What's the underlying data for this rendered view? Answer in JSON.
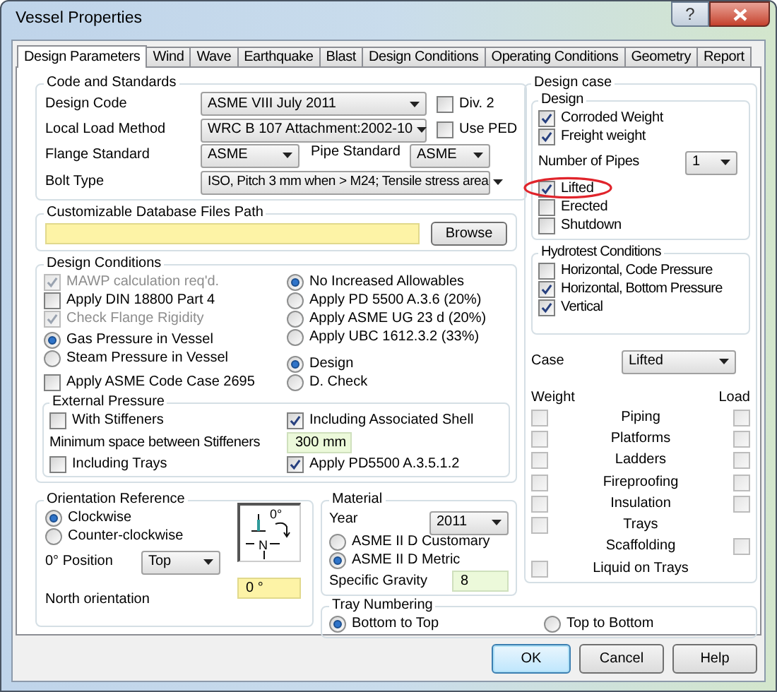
{
  "window": {
    "title": "Vessel Properties",
    "help_button": "?"
  },
  "tabs": [
    {
      "label": "Design Parameters",
      "selected": true
    },
    {
      "label": "Wind",
      "selected": false
    },
    {
      "label": "Wave",
      "selected": false
    },
    {
      "label": "Earthquake",
      "selected": false
    },
    {
      "label": "Blast",
      "selected": false
    },
    {
      "label": "Design Conditions",
      "selected": false
    },
    {
      "label": "Operating Conditions",
      "selected": false
    },
    {
      "label": "Geometry",
      "selected": false
    },
    {
      "label": "Report",
      "selected": false
    }
  ],
  "code_and_standards": {
    "title": "Code and Standards",
    "design_code": {
      "label": "Design Code",
      "value": "ASME VIII July 2011"
    },
    "div2": {
      "label": "Div. 2",
      "checked": false
    },
    "local_load_method": {
      "label": "Local Load Method",
      "value": "WRC B 107 Attachment:2002-10"
    },
    "use_ped": {
      "label": "Use PED",
      "checked": false
    },
    "flange_standard": {
      "label": "Flange Standard",
      "value": "ASME"
    },
    "pipe_standard": {
      "label": "Pipe Standard",
      "value": "ASME"
    },
    "bolt_type": {
      "label": "Bolt Type",
      "value": "ISO, Pitch 3 mm when > M24; Tensile stress area"
    }
  },
  "database_path": {
    "title": "Customizable Database Files Path",
    "browse_button": "Browse"
  },
  "design_conditions": {
    "title": "Design Conditions",
    "options": [
      {
        "label": "MAWP calculation req'd.",
        "checked": true,
        "disabled": true
      },
      {
        "label": "Apply DIN 18800 Part 4",
        "checked": false,
        "disabled": false
      },
      {
        "label": "Check Flange Rigidity",
        "checked": true,
        "disabled": true
      }
    ],
    "pressure_medium": [
      {
        "label": "Gas Pressure in Vessel",
        "selected": true
      },
      {
        "label": "Steam Pressure in Vessel",
        "selected": false
      }
    ],
    "code_case": {
      "label": "Apply ASME Code Case 2695",
      "checked": false
    },
    "allowables": [
      {
        "label": "No Increased Allowables",
        "selected": true
      },
      {
        "label": "Apply PD 5500 A.3.6 (20%)",
        "selected": false
      },
      {
        "label": "Apply ASME UG 23 d (20%)",
        "selected": false
      },
      {
        "label": "Apply UBC 1612.3.2 (33%)",
        "selected": false
      }
    ],
    "check_mode": [
      {
        "label": "Design",
        "selected": true
      },
      {
        "label": "D. Check",
        "selected": false
      }
    ],
    "external_pressure": {
      "title": "External Pressure",
      "with_stiffeners": {
        "label": "With Stiffeners",
        "checked": false
      },
      "including_shell": {
        "label": "Including Associated Shell",
        "checked": true
      },
      "min_space": {
        "label": "Minimum space between Stiffeners",
        "value": "300 mm"
      },
      "including_trays": {
        "label": "Including Trays",
        "checked": false
      },
      "apply_pd5500": {
        "label": "Apply PD5500 A.3.5.1.2",
        "checked": true
      }
    }
  },
  "orientation": {
    "title": "Orientation Reference",
    "direction": [
      {
        "label": "Clockwise",
        "selected": true
      },
      {
        "label": "Counter-clockwise",
        "selected": false
      }
    ],
    "zero_position": {
      "label": "0° Position",
      "value": "Top"
    },
    "diagram": {
      "zero_label": "0°",
      "north_label": "N"
    },
    "north_orientation": {
      "label": "North orientation",
      "value": "0 °"
    }
  },
  "material": {
    "title": "Material",
    "year": {
      "label": "Year",
      "value": "2011"
    },
    "units": [
      {
        "label": "ASME II D Customary",
        "selected": false
      },
      {
        "label": "ASME II D Metric",
        "selected": true
      }
    ],
    "specific_gravity": {
      "label": "Specific Gravity",
      "value": "8"
    }
  },
  "tray_numbering": {
    "title": "Tray Numbering",
    "options": [
      {
        "label": "Bottom to Top",
        "selected": true
      },
      {
        "label": "Top to Bottom",
        "selected": false
      }
    ]
  },
  "design_case": {
    "title": "Design case",
    "design": {
      "title": "Design",
      "options": [
        {
          "label": "Corroded Weight",
          "checked": true
        },
        {
          "label": "Freight weight",
          "checked": true
        }
      ],
      "number_of_pipes": {
        "label": "Number of Pipes",
        "value": "1"
      },
      "conditions": [
        {
          "label": "Lifted",
          "checked": true,
          "highlighted": true
        },
        {
          "label": "Erected",
          "checked": false,
          "highlighted": false
        },
        {
          "label": "Shutdown",
          "checked": false,
          "highlighted": false
        }
      ]
    },
    "hydrotest": {
      "title": "Hydrotest Conditions",
      "options": [
        {
          "label": "Horizontal, Code Pressure",
          "checked": false
        },
        {
          "label": "Horizontal, Bottom Pressure",
          "checked": true
        },
        {
          "label": "Vertical",
          "checked": true
        }
      ]
    },
    "case": {
      "label": "Case",
      "value": "Lifted"
    },
    "weight_header": "Weight",
    "load_header": "Load",
    "loads": [
      {
        "label": "Piping",
        "weight": {
          "checked": false,
          "disabled": true
        },
        "load": {
          "checked": false,
          "disabled": true
        }
      },
      {
        "label": "Platforms",
        "weight": {
          "checked": false,
          "disabled": true
        },
        "load": {
          "checked": false,
          "disabled": true
        }
      },
      {
        "label": "Ladders",
        "weight": {
          "checked": false,
          "disabled": true
        },
        "load": {
          "checked": false,
          "disabled": true
        }
      },
      {
        "label": "Fireproofing",
        "weight": {
          "checked": false,
          "disabled": true
        },
        "load": {
          "checked": false,
          "disabled": true
        }
      },
      {
        "label": "Insulation",
        "weight": {
          "checked": false,
          "disabled": true
        },
        "load": {
          "checked": false,
          "disabled": true
        }
      },
      {
        "label": "Trays",
        "weight": {
          "checked": false,
          "disabled": true
        }
      },
      {
        "label": "Scaffolding",
        "load": {
          "checked": false,
          "disabled": true
        }
      },
      {
        "label": "Liquid on Trays",
        "weight": {
          "checked": false,
          "disabled": true
        }
      }
    ]
  },
  "buttons": [
    {
      "label": "OK",
      "default": true
    },
    {
      "label": "Cancel",
      "default": false
    },
    {
      "label": "Help",
      "default": false
    }
  ]
}
